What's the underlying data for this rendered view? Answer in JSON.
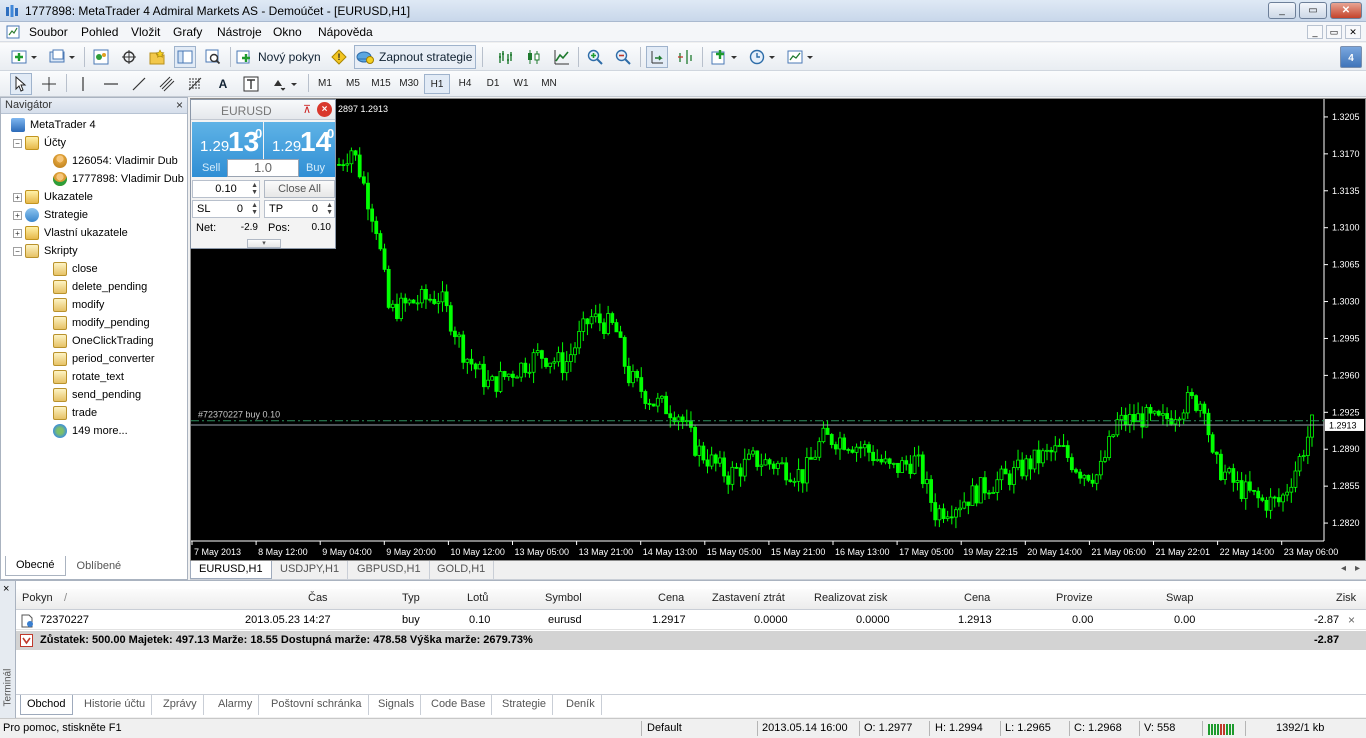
{
  "window": {
    "title": "1777898: MetaTrader 4 Admiral Markets AS - Demoúčet - [EURUSD,H1]",
    "btn_min": "_",
    "btn_max": "▭",
    "btn_close": "✕"
  },
  "menu": {
    "items": [
      "Soubor",
      "Pohled",
      "Vložit",
      "Grafy",
      "Nástroje",
      "Okno",
      "Nápověda"
    ]
  },
  "toolbar": {
    "new_order_label": "Nový pokyn",
    "autotrading_label": "Zapnout strategie",
    "timeframes": [
      "M1",
      "M5",
      "M15",
      "M30",
      "H1",
      "H4",
      "D1",
      "W1",
      "MN"
    ],
    "active_timeframe": "H1",
    "text_tool": "A"
  },
  "navigator": {
    "title": "Navigátor",
    "close": "×",
    "root": "MetaTrader 4",
    "accounts_label": "Účty",
    "accounts": [
      "126054: Vladimir  Dub",
      "1777898: Vladimir Dub"
    ],
    "indicators_label": "Ukazatele",
    "experts_label": "Strategie",
    "custom_label": "Vlastní ukazatele",
    "scripts_label": "Skripty",
    "scripts": [
      "close",
      "delete_pending",
      "modify",
      "modify_pending",
      "OneClickTrading",
      "period_converter",
      "rotate_text",
      "send_pending",
      "trade"
    ],
    "more": "149 more...",
    "tabs": [
      "Obecné",
      "Oblíbené"
    ]
  },
  "one_click": {
    "symbol": "EURUSD",
    "sell_small": "1.29",
    "sell_big": "13",
    "sell_sup": "0",
    "buy_small": "1.29",
    "buy_big": "14",
    "buy_sup": "0",
    "sell_label": "Sell",
    "buy_label": "Buy",
    "lot": "1.0",
    "step": "0.10",
    "close_all": "Close All",
    "sl_label": "SL",
    "sl_value": "0",
    "tp_label": "TP",
    "tp_value": "0",
    "net_label": "Net:",
    "net_value": "-2.9",
    "pos_label": "Pos:",
    "pos_value": "0.10"
  },
  "chart": {
    "header_text": "2897 1.2913",
    "order_line_label": "#72370227 buy 0.10",
    "current_price_label": "1.2913",
    "colors": {
      "background": "#000000",
      "candle": "#00ff00",
      "grid": "#ffffff"
    }
  },
  "chart_data": {
    "type": "candlestick",
    "symbol": "EURUSD",
    "timeframe": "H1",
    "y_ticks": [
      "1.3205",
      "1.3170",
      "1.3135",
      "1.3100",
      "1.3065",
      "1.3030",
      "1.2995",
      "1.2960",
      "1.2925",
      "1.2890",
      "1.2855",
      "1.2820"
    ],
    "ylim": [
      1.2803,
      1.3222
    ],
    "x_ticks": [
      "7 May 2013",
      "8 May 12:00",
      "9 May 04:00",
      "9 May 20:00",
      "10 May 12:00",
      "13 May 05:00",
      "13 May 21:00",
      "14 May 13:00",
      "15 May 05:00",
      "15 May 21:00",
      "16 May 13:00",
      "17 May 05:00",
      "19 May 22:15",
      "20 May 14:00",
      "21 May 06:00",
      "21 May 22:01",
      "22 May 14:00",
      "23 May 06:00"
    ],
    "current_price": 1.2913,
    "order_price": 1.2917,
    "close_path": [
      [
        0,
        1.316
      ],
      [
        2,
        1.3175
      ],
      [
        3,
        1.316
      ],
      [
        5,
        1.312
      ],
      [
        6,
        1.31
      ],
      [
        8,
        1.302
      ],
      [
        12,
        1.303
      ],
      [
        16,
        1.3035
      ],
      [
        18,
        1.301
      ],
      [
        20,
        1.298
      ],
      [
        24,
        1.295
      ],
      [
        28,
        1.2965
      ],
      [
        32,
        1.298
      ],
      [
        36,
        1.297
      ],
      [
        40,
        1.3015
      ],
      [
        44,
        1.3005
      ],
      [
        46,
        1.296
      ],
      [
        50,
        1.2935
      ],
      [
        54,
        1.2925
      ],
      [
        57,
        1.289
      ],
      [
        62,
        1.2865
      ],
      [
        66,
        1.288
      ],
      [
        70,
        1.2875
      ],
      [
        74,
        1.2865
      ],
      [
        77,
        1.29
      ],
      [
        80,
        1.29
      ],
      [
        84,
        1.289
      ],
      [
        88,
        1.287
      ],
      [
        92,
        1.288
      ],
      [
        95,
        1.283
      ],
      [
        99,
        1.284
      ],
      [
        103,
        1.2855
      ],
      [
        107,
        1.2865
      ],
      [
        111,
        1.288
      ],
      [
        115,
        1.289
      ],
      [
        118,
        1.287
      ],
      [
        121,
        1.2865
      ],
      [
        124,
        1.2915
      ],
      [
        128,
        1.292
      ],
      [
        131,
        1.2915
      ],
      [
        135,
        1.2935
      ],
      [
        138,
        1.2935
      ],
      [
        139,
        1.288
      ],
      [
        143,
        1.2855
      ],
      [
        147,
        1.284
      ],
      [
        150,
        1.284
      ],
      [
        153,
        1.288
      ],
      [
        155,
        1.2913
      ]
    ]
  },
  "chart_tabs": [
    "EURUSD,H1",
    "USDJPY,H1",
    "GBPUSD,H1",
    "GOLD,H1"
  ],
  "terminal": {
    "side_label": "Terminál",
    "headers": [
      "Pokyn",
      "/",
      "Čas",
      "Typ",
      "Lotů",
      "Symbol",
      "Cena",
      "Zastavení ztrát",
      "Realizovat zisk",
      "Cena",
      "Provize",
      "Swap",
      "Zisk"
    ],
    "row": {
      "ticket": "72370227",
      "time": "2013.05.23 14:27",
      "type": "buy",
      "lots": "0.10",
      "symbol": "eurusd",
      "price": "1.2917",
      "sl": "0.0000",
      "tp": "0.0000",
      "current": "1.2913",
      "commission": "0.00",
      "swap": "0.00",
      "profit": "-2.87"
    },
    "balance_text": "Zůstatek: 500.00  Majetek: 497.13  Marže: 18.55  Dostupná marže: 478.58  Výška marže: 2679.73%",
    "balance_profit": "-2.87",
    "close_x": "×",
    "tabs": [
      "Obchod",
      "Historie účtu",
      "Zprávy",
      "Alarmy",
      "Poštovní schránka",
      "Signals",
      "Code Base",
      "Strategie",
      "Deník"
    ]
  },
  "status": {
    "help": "Pro pomoc, stiskněte F1",
    "profile": "Default",
    "datetime": "2013.05.14 16:00",
    "open": "O: 1.2977",
    "high": "H: 1.2994",
    "low": "L: 1.2965",
    "close": "C: 1.2968",
    "volume": "V: 558",
    "traffic": "1392/1 kb"
  }
}
